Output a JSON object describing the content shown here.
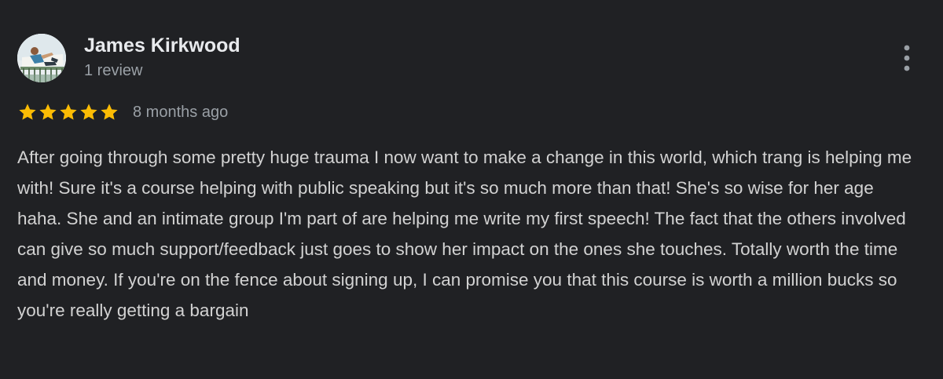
{
  "review": {
    "author_name": "James Kirkwood",
    "author_review_count": "1 review",
    "rating_stars": 5,
    "rating_max": 5,
    "star_color": "#fbbc04",
    "time_ago": "8 months ago",
    "text": "After going through some pretty huge trauma I now want to make a change in this world, which trang is helping me with! Sure it's a course helping with public speaking but it's so much more than that! She's so wise for her age haha. She and an intimate group I'm part of are helping me write my first speech! The fact that the others involved can give so much support/feedback just goes to show her impact on the ones she touches. Totally worth the time and money. If you're on the fence about signing up, I can promise you that this course is worth a million bucks so you're really getting a bargain"
  },
  "icons": {
    "avatar": "avatar-photo",
    "menu": "more-vert-icon",
    "star": "star-icon"
  },
  "colors": {
    "background": "#202124",
    "primary_text": "#e8eaed",
    "secondary_text": "#9aa0a6"
  }
}
